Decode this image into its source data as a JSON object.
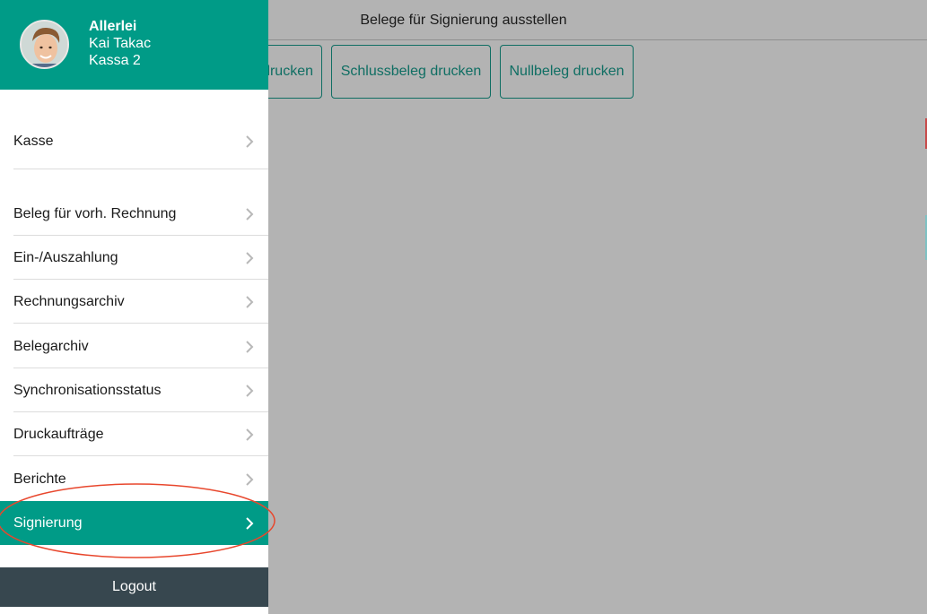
{
  "background": {
    "title": "Belege für Signierung ausstellen",
    "buttons": [
      {
        "label": "drucken"
      },
      {
        "label": "Schlussbeleg drucken"
      },
      {
        "label": "Nullbeleg drucken"
      }
    ]
  },
  "drawer": {
    "store": "Allerlei",
    "user": "Kai Takac",
    "register": "Kassa 2",
    "menu": [
      {
        "label": "Kasse"
      },
      {
        "label": "Beleg für vorh. Rechnung"
      },
      {
        "label": "Ein-/Auszahlung"
      },
      {
        "label": "Rechnungsarchiv"
      },
      {
        "label": "Belegarchiv"
      },
      {
        "label": "Synchronisationsstatus"
      },
      {
        "label": "Druckaufträge"
      },
      {
        "label": "Berichte"
      },
      {
        "label": "Signierung"
      }
    ],
    "logout": "Logout"
  },
  "colors": {
    "accent": "#009b87",
    "overlay": "#b3b3b3",
    "logout_bg": "#37474f",
    "annotation": "#e8472d"
  }
}
